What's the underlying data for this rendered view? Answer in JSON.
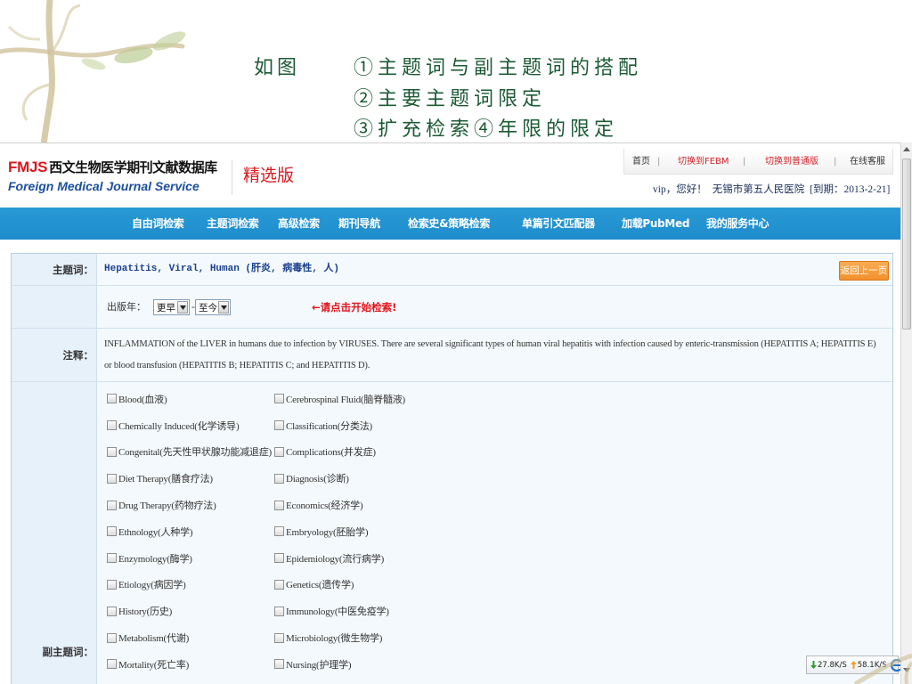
{
  "slide": {
    "lead": "如图",
    "points": [
      "①主题词与副主题词的搭配",
      "②主要主题词限定",
      "③扩充检索④年限的限定"
    ]
  },
  "header": {
    "logo_abbr": "FMJS",
    "logo_cn": "西文生物医学期刊文献数据库",
    "logo_en": "Foreign Medical Journal Service",
    "edition": "精选版",
    "links": {
      "home": "首页",
      "febm": "切换到FEBM",
      "normal": "切换到普通版",
      "support": "在线客服",
      "separator": "|"
    },
    "greeting": "vip，您好！",
    "institution": "无锡市第五人民医院",
    "expiry": "[到期：2013-2-21]"
  },
  "nav": [
    "自由词检索",
    "主题词检索",
    "高级检索",
    "期刊导航",
    "检索史&策略检索",
    "单篇引文匹配器",
    "加载PubMed",
    "我的服务中心"
  ],
  "form": {
    "subject_label": "主题词：",
    "subject_term": "Hepatitis, Viral, Human (肝炎, 病毒性, 人)",
    "back_button": "返回上一页",
    "year_label": "出版年：",
    "year_from": "更早",
    "year_separator": "-",
    "year_to": "至今",
    "hint": "←请点击开始检索!",
    "note_label": "注释：",
    "note_text": "INFLAMMATION of the LIVER in humans due to infection by VIRUSES. There are several significant types of human viral hepatitis with infection caused by enteric-transmission (HEPATITIS A; HEPATITIS E) or blood transfusion (HEPATITIS B; HEPATITIS C; and HEPATITIS D).",
    "subheading_label": "副主题词：",
    "subheadings": {
      "left": [
        "Blood(血液)",
        "Chemically Induced(化学诱导)",
        "Congenital(先天性甲状腺功能减退症)",
        "Diet Therapy(膳食疗法)",
        "Drug Therapy(药物疗法)",
        "Ethnology(人种学)",
        "Enzymology(酶学)",
        "Etiology(病因学)",
        "History(历史)",
        "Metabolism(代谢)",
        "Mortality(死亡率)"
      ],
      "right": [
        "Cerebrospinal Fluid(脑脊髓液)",
        "Classification(分类法)",
        "Complications(并发症)",
        "Diagnosis(诊断)",
        "Economics(经济学)",
        "Embryology(胚胎学)",
        "Epidemiology(流行病学)",
        "Genetics(遗传学)",
        "Immunology(中医免疫学)",
        "Microbiology(微生物学)",
        "Nursing(护理学)"
      ]
    }
  },
  "status": {
    "download": "27.8K/S",
    "upload": "58.1K/S"
  },
  "icons": {
    "download": "arrow-down-icon",
    "upload": "arrow-up-icon",
    "browser": "ie-icon",
    "select": "chevron-down-icon"
  },
  "colors": {
    "title_green": "#1d5b35",
    "nav_blue": "#1d8ccc",
    "brand_red": "#d7191f",
    "brand_blue": "#1b4f9e",
    "hint_red": "#e3141b",
    "button_orange": "#f2912c"
  }
}
